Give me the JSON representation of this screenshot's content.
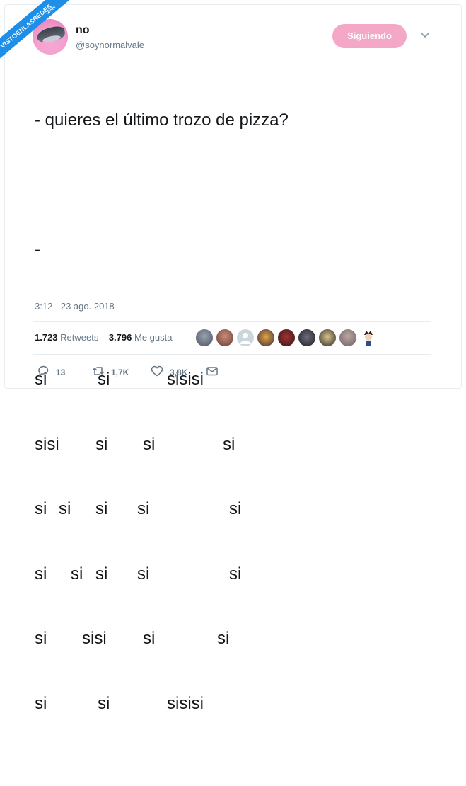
{
  "watermark": {
    "main": "VISTOENLASREDES",
    "sub": ".com"
  },
  "user": {
    "name": "no",
    "handle": "@soynormalvale"
  },
  "follow_label": "Siguiendo",
  "tweet": {
    "question": "- quieres el último trozo de pizza?",
    "dash": "-",
    "rows": [
      [
        "si",
        "si",
        "sisisi"
      ],
      [
        "sisi",
        "si",
        "si",
        "si"
      ],
      [
        "si",
        "si",
        "si",
        "si",
        "si"
      ],
      [
        "si",
        "si",
        "si",
        "si",
        "si"
      ],
      [
        "si",
        "sisi",
        "si",
        "si"
      ],
      [
        "si",
        "si",
        "sisisi"
      ]
    ]
  },
  "timestamp": "3:12 - 23 ago. 2018",
  "stats": {
    "retweets_count": "1.723",
    "retweets_label": "Retweets",
    "likes_count": "3.796",
    "likes_label": "Me gusta"
  },
  "actions": {
    "replies": "13",
    "retweets": "1,7K",
    "likes": "3,8K"
  },
  "colors": {
    "accent_pink": "#f5a7c8",
    "watermark_blue": "#1d8fe8",
    "muted": "#657786"
  },
  "icons": [
    "reply-icon",
    "retweet-icon",
    "like-icon",
    "dm-icon",
    "chevron-down-icon"
  ]
}
